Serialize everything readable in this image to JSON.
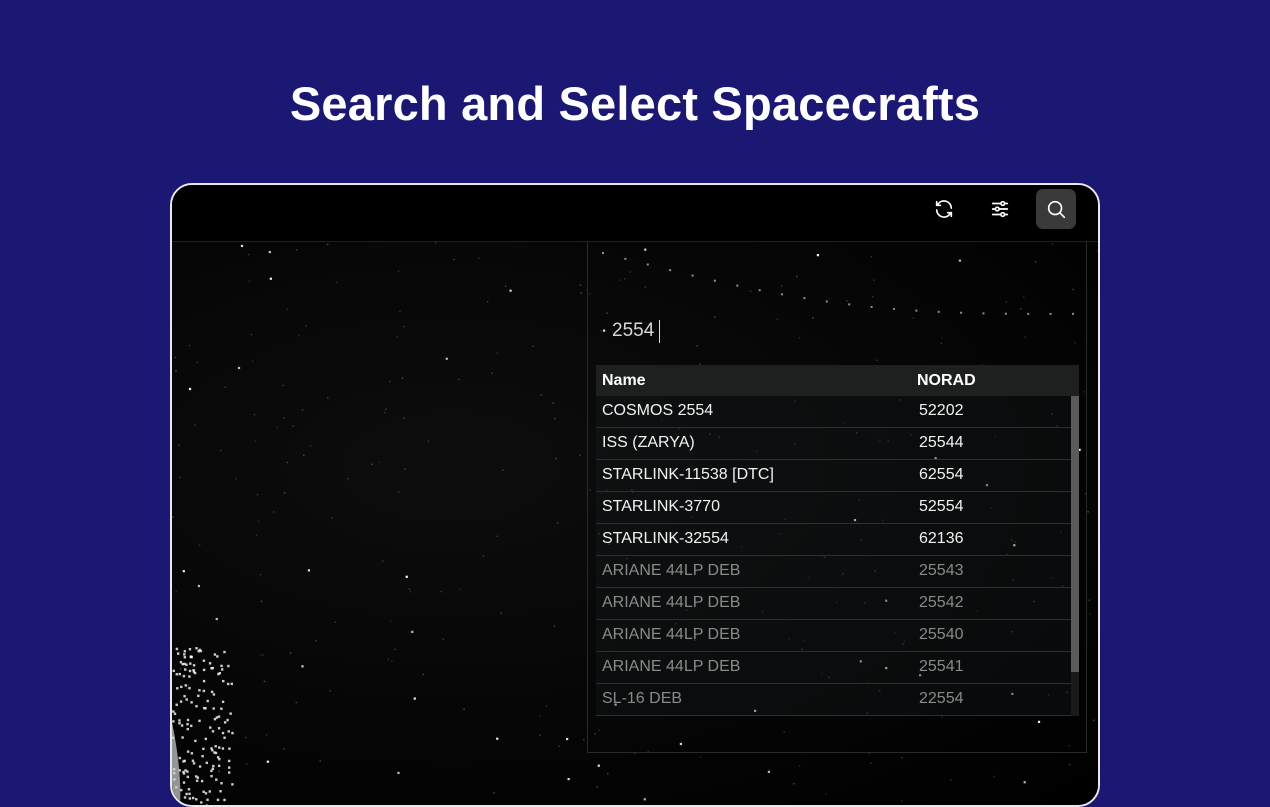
{
  "page": {
    "title": "Search and Select Spacecrafts"
  },
  "toolbar": {
    "buttons": [
      {
        "icon": "refresh-icon"
      },
      {
        "icon": "sliders-icon"
      },
      {
        "icon": "search-icon",
        "active": true
      }
    ]
  },
  "search": {
    "value": "2554"
  },
  "results": {
    "columns": [
      "Name",
      "NORAD"
    ],
    "rows": [
      {
        "name": "COSMOS 2554",
        "norad": "52202",
        "dim": false
      },
      {
        "name": "ISS (ZARYA)",
        "norad": "25544",
        "dim": false
      },
      {
        "name": "STARLINK-11538 [DTC]",
        "norad": "62554",
        "dim": false
      },
      {
        "name": "STARLINK-3770",
        "norad": "52554",
        "dim": false
      },
      {
        "name": "STARLINK-32554",
        "norad": "62136",
        "dim": false
      },
      {
        "name": "ARIANE 44LP DEB",
        "norad": "25543",
        "dim": true
      },
      {
        "name": "ARIANE 44LP DEB",
        "norad": "25542",
        "dim": true
      },
      {
        "name": "ARIANE 44LP DEB",
        "norad": "25540",
        "dim": true
      },
      {
        "name": "ARIANE 44LP DEB",
        "norad": "25541",
        "dim": true
      },
      {
        "name": "SL-16 DEB",
        "norad": "22554",
        "dim": true
      }
    ]
  },
  "colors": {
    "background": "#1b1874",
    "active_button": "#3a3a3a",
    "dim_text": "#8a8a8a"
  }
}
